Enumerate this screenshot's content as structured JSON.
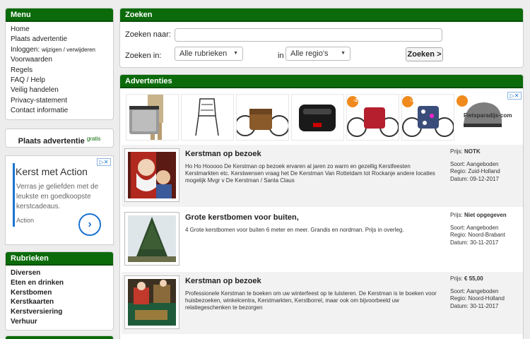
{
  "menu": {
    "title": "Menu",
    "items": [
      "Home",
      "Plaats advertentie",
      "Inloggen:",
      "Voorwaarden",
      "Regels",
      "FAQ / Help",
      "Veilig handelen",
      "Privacy-statement",
      "Contact informatie"
    ],
    "login_sub": "wijzigen / verwijderen"
  },
  "place_ad": {
    "label": "Plaats advertentie",
    "badge": "gratis"
  },
  "side_ad": {
    "title": "Kerst met Action",
    "text": "Verras je geliefden met de leukste en goedkoopste kerstcadeaus.",
    "action": "Action",
    "arrow": "›"
  },
  "rubrieken": {
    "title": "Rubrieken",
    "items": [
      "Diversen",
      "Eten en drinken",
      "Kerstbomen",
      "Kerstkaarten",
      "Kerstversiering",
      "Verhuur"
    ]
  },
  "search": {
    "title": "Zoeken",
    "label_query": "Zoeken naar:",
    "label_in": "Zoeken in:",
    "category": "Alle rubrieken",
    "in_label": "in",
    "region": "Alle regio's",
    "button": "Zoeken >"
  },
  "ads_panel": {
    "title": "Advertenties",
    "banner_brand": "Fietsparadijs",
    "banner_brand_suffix": "·com",
    "badge1": "-20%",
    "badge2": "-13%"
  },
  "listings": [
    {
      "title": "Kerstman op bezoek",
      "desc": "Ho Ho Hooooo De Kerstman op bezoek ervaren al jaren zo warm en gezellig Kerstfeesten Kerstmarkten etc. Kerstwensen vraag het De Kerstman Van Rottetdam tot Rockanje andere locaties mogelijk Mvgr v De Kerstman / Santa Claus",
      "price_label": "Prijs:",
      "price": "NOTK",
      "sort": "Soort: Aangeboden",
      "region": "Regio: Zuid-Holland",
      "date": "Datum: 09-12-2017"
    },
    {
      "title": "Grote kerstbomen voor buiten,",
      "desc": "4 Grote kerstbomen voor buiten 6 meter en meer. Grandis en nordman. Prijs in overleg.",
      "price_label": "Prijs:",
      "price": "Niet opgegeven",
      "sort": "Soort: Aangeboden",
      "region": "Regio: Noord-Brabant",
      "date": "Datum: 30-11-2017"
    },
    {
      "title": "Kerstman op bezoek",
      "desc": "Professionele Kerstman te boeken om uw winterfeest op te luisteren. De Kerstman is te boeken voor huisbezoeken, winkelcentra, Kerstmarkten, Kerstborrel, maar ook om bijvoorbeeld uw relatiegeschenken te bezorgen",
      "price_label": "Prijs:",
      "price": "€ 55,00",
      "sort": "Soort: Aangeboden",
      "region": "Regio: Noord-Holland",
      "date": "Datum: 30-11-2017"
    }
  ]
}
